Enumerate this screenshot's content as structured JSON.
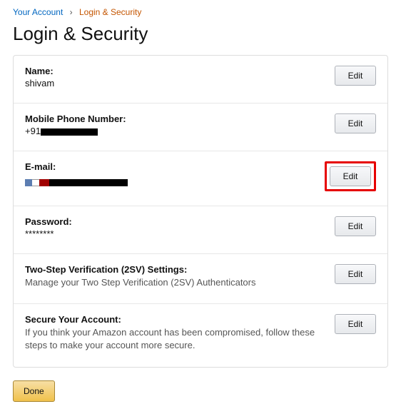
{
  "breadcrumb": {
    "root": "Your Account",
    "separator": "›",
    "current": "Login & Security"
  },
  "page_title": "Login & Security",
  "rows": {
    "name": {
      "label": "Name:",
      "value": "shivam",
      "edit": "Edit"
    },
    "mobile": {
      "label": "Mobile Phone Number:",
      "prefix": "+91",
      "edit": "Edit"
    },
    "email": {
      "label": "E-mail:",
      "edit": "Edit"
    },
    "password": {
      "label": "Password:",
      "value": "********",
      "edit": "Edit"
    },
    "twostep": {
      "label": "Two-Step Verification (2SV) Settings:",
      "desc": "Manage your Two Step Verification (2SV) Authenticators",
      "edit": "Edit"
    },
    "secure": {
      "label": "Secure Your Account:",
      "desc": "If you think your Amazon account has been compromised, follow these steps to make your account more secure.",
      "edit": "Edit"
    }
  },
  "done_label": "Done"
}
